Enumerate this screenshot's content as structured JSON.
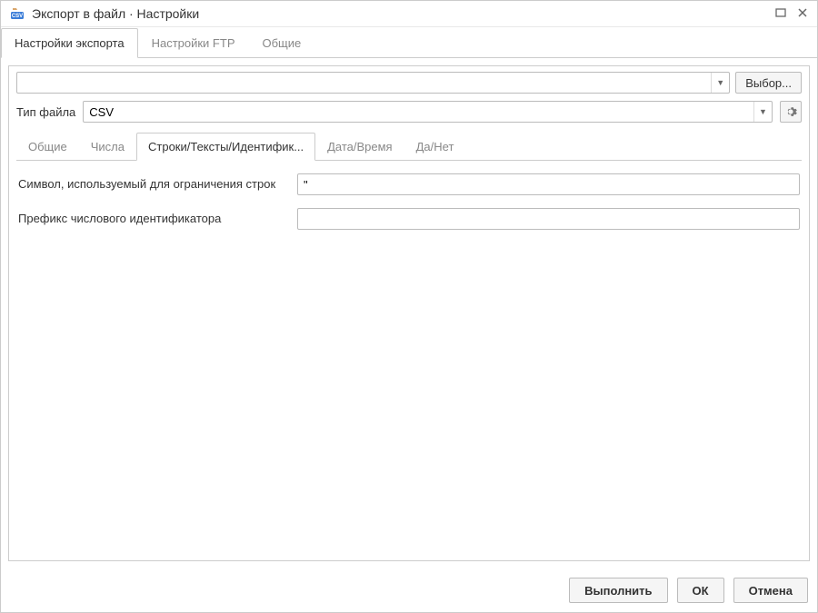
{
  "window": {
    "title": "Экспорт в файл · Настройки"
  },
  "upper_tabs": [
    {
      "label": "Настройки экспорта",
      "active": true
    },
    {
      "label": "Настройки FTP",
      "active": false
    },
    {
      "label": "Общие",
      "active": false
    }
  ],
  "panel": {
    "path_value": "",
    "select_button": "Выбор...",
    "file_type_label": "Тип файла",
    "file_type_value": "CSV"
  },
  "sub_tabs": [
    {
      "label": "Общие",
      "active": false
    },
    {
      "label": "Числа",
      "active": false
    },
    {
      "label": "Строки/Тексты/Идентифик...",
      "active": true
    },
    {
      "label": "Дата/Время",
      "active": false
    },
    {
      "label": "Да/Нет",
      "active": false
    }
  ],
  "form": {
    "row1_label": "Символ, используемый для ограничения строк",
    "row1_value": "\"",
    "row2_label": "Префикс числового идентификатора",
    "row2_value": ""
  },
  "footer": {
    "execute": "Выполнить",
    "ok": "ОК",
    "cancel": "Отмена"
  }
}
